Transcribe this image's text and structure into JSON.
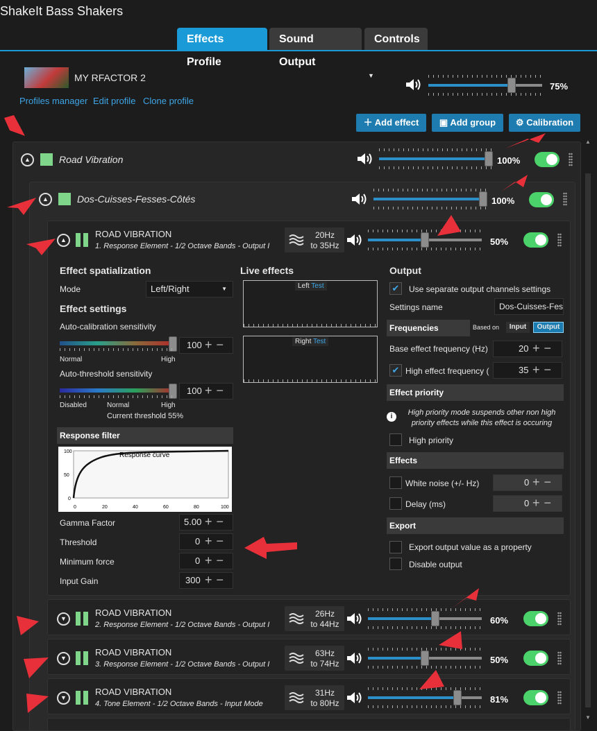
{
  "app": {
    "title": "ShakeIt Bass Shakers"
  },
  "tabs": [
    "Effects Profile",
    "Sound Output",
    "Controls"
  ],
  "profile": {
    "name": "MY RFACTOR 2",
    "volume_pct": "75%",
    "volume": 0.75
  },
  "links": {
    "manager": "Profiles manager",
    "edit": "Edit profile",
    "clone": "Clone profile"
  },
  "toolbar": {
    "add_effect": "Add effect",
    "add_group": "Add group",
    "calibration": "Calibration"
  },
  "groups": [
    {
      "name": "Road Vibration",
      "volume_pct": "100%",
      "volume": 1.0
    },
    {
      "name": "Dos-Cuisses-Fesses-Côtés",
      "volume_pct": "100%",
      "volume": 1.0
    }
  ],
  "effects": [
    {
      "title": "ROAD VIBRATION",
      "subtitle": "1. Response Element - 1/2 Octave Bands - Output I",
      "hz_top": "20Hz",
      "hz_bot": "to 35Hz",
      "volume_pct": "50%",
      "volume": 0.5
    },
    {
      "title": "ROAD VIBRATION",
      "subtitle": "2. Response Element - 1/2 Octave Bands - Output I",
      "hz_top": "26Hz",
      "hz_bot": "to 44Hz",
      "volume_pct": "60%",
      "volume": 0.6
    },
    {
      "title": "ROAD VIBRATION",
      "subtitle": "3. Response Element - 1/2 Octave Bands - Output I",
      "hz_top": "63Hz",
      "hz_bot": "to 74Hz",
      "volume_pct": "50%",
      "volume": 0.5
    },
    {
      "title": "ROAD VIBRATION",
      "subtitle": "4. Tone Element - 1/2 Octave Bands - Input Mode",
      "hz_top": "31Hz",
      "hz_bot": "to 80Hz",
      "volume_pct": "81%",
      "volume": 0.81
    }
  ],
  "detail": {
    "spatialization": {
      "title": "Effect spatialization",
      "mode_label": "Mode",
      "mode_value": "Left/Right"
    },
    "settings": {
      "title": "Effect settings",
      "auto_cal": {
        "label": "Auto-calibration sensitivity",
        "value": "100",
        "lo": "Normal",
        "hi": "High"
      },
      "auto_thr": {
        "label": "Auto-threshold sensitivity",
        "value": "100",
        "lo": "Disabled",
        "mid": "Normal",
        "hi": "High",
        "current": "Current threshold 55%"
      }
    },
    "response": {
      "title": "Response filter",
      "curve_label": "Response curve",
      "y_ticks": [
        "100",
        "50",
        "0"
      ],
      "x_ticks": [
        "0",
        "20",
        "40",
        "60",
        "80",
        "100"
      ],
      "gamma_label": "Gamma Factor",
      "gamma": "5.00",
      "threshold_label": "Threshold",
      "threshold": "0",
      "minforce_label": "Minimum force",
      "minforce": "0",
      "gain_label": "Input Gain",
      "gain": "300"
    },
    "live": {
      "title": "Live effects",
      "left": "Left",
      "right": "Right",
      "test": "Test"
    },
    "output": {
      "title": "Output",
      "separate": "Use separate output channels settings",
      "settings_name_label": "Settings name",
      "settings_name": "Dos-Cuisses-Fess",
      "freq_title": "Frequencies",
      "based_on": "Based on",
      "input": "Input",
      "output": "Output",
      "base_label": "Base effect frequency (Hz)",
      "base": "20",
      "high_label": "High effect frequency (",
      "high": "35",
      "prio_title": "Effect priority",
      "prio_info": "High priority mode suspends other non high priority effects while this effect is occuring",
      "high_prio": "High priority",
      "effects_title": "Effects",
      "white_noise": "White noise (+/- Hz)",
      "white_noise_val": "0",
      "delay": "Delay (ms)",
      "delay_val": "0",
      "export_title": "Export",
      "export_prop": "Export output value as a property",
      "disable_out": "Disable output"
    }
  },
  "colors": {
    "accent": "#1a9ad6",
    "toggle": "#4cd26b",
    "annotation": "#e8303a",
    "group_color": "#7fd68a"
  }
}
